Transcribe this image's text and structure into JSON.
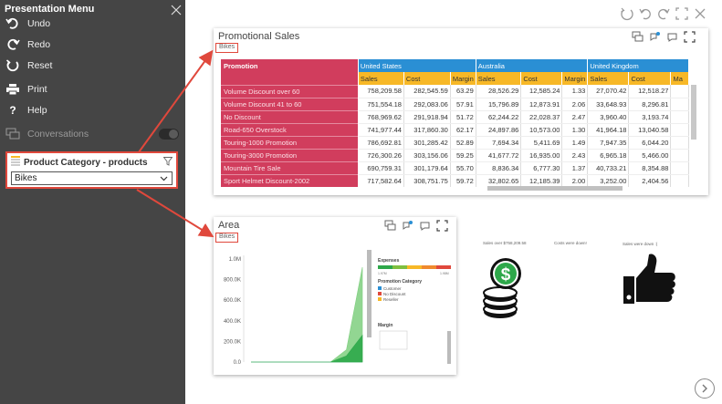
{
  "sidebar": {
    "title": "Presentation Menu",
    "items": [
      {
        "label": "Undo",
        "icon": "undo-icon"
      },
      {
        "label": "Redo",
        "icon": "redo-icon"
      },
      {
        "label": "Reset",
        "icon": "reset-icon"
      },
      {
        "label": "Print",
        "icon": "print-icon"
      },
      {
        "label": "Help",
        "icon": "help-icon"
      },
      {
        "label": "Conversations",
        "icon": "conversations-icon"
      }
    ],
    "filter": {
      "title": "Product Category - products",
      "selected": "Bikes"
    }
  },
  "promo_panel": {
    "title": "Promotional Sales",
    "filter_tag": "Bikes",
    "table": {
      "row_header": "Promotion",
      "countries": [
        "United States",
        "Australia",
        "United Kingdom"
      ],
      "measures": [
        "Sales",
        "Cost",
        "Margin",
        "Sales",
        "Cost",
        "Margin",
        "Sales",
        "Cost",
        "Ma"
      ],
      "rows": [
        {
          "name": "Volume Discount over 60",
          "values": [
            "758,209.58",
            "282,545.59",
            "63.29",
            "28,526.29",
            "12,585.24",
            "1.33",
            "27,070.42",
            "12,518.27"
          ]
        },
        {
          "name": "Volume Discount 41 to 60",
          "values": [
            "751,554.18",
            "292,083.06",
            "57.91",
            "15,796.89",
            "12,873.91",
            "2.06",
            "33,648.93",
            "8,296.81"
          ]
        },
        {
          "name": "No Discount",
          "values": [
            "768,969.62",
            "291,918.94",
            "51.72",
            "62,244.22",
            "22,028.37",
            "2.47",
            "3,960.40",
            "3,193.74"
          ]
        },
        {
          "name": "Road-650 Overstock",
          "values": [
            "741,977.44",
            "317,860.30",
            "62.17",
            "24,897.86",
            "10,573.00",
            "1.30",
            "41,964.18",
            "13,040.58"
          ]
        },
        {
          "name": "Touring-1000 Promotion",
          "values": [
            "786,692.81",
            "301,285.42",
            "52.89",
            "7,694.34",
            "5,411.69",
            "1.49",
            "7,947.35",
            "6,044.20"
          ]
        },
        {
          "name": "Touring-3000 Promotion",
          "values": [
            "726,300.26",
            "303,156.06",
            "59.25",
            "41,677.72",
            "16,935.00",
            "2.43",
            "6,965.18",
            "5,466.00"
          ]
        },
        {
          "name": "Mountain Tire Sale",
          "values": [
            "690,759.31",
            "301,179.64",
            "55.70",
            "8,836.34",
            "6,777.30",
            "1.37",
            "40,733.21",
            "8,354.88"
          ]
        },
        {
          "name": "Sport Helmet Discount-2002",
          "values": [
            "717,582.64",
            "308,751.75",
            "59.72",
            "32,802.65",
            "12,185.39",
            "2.00",
            "3,252.00",
            "2,404.56"
          ]
        }
      ]
    }
  },
  "area_panel": {
    "title": "Area",
    "filter_tag": "Bikes",
    "legend": {
      "expenses_title": "Expenses",
      "expenses_min": "1.97M",
      "expenses_max": "1.98M",
      "category_title": "Promotion Category",
      "categories": [
        "Customer",
        "No Discount",
        "Reseller"
      ],
      "margin_title": "Margin"
    }
  },
  "cards": {
    "sales_label": "Sales over $758,209.58",
    "costs_label": "Costs were down!",
    "sales_down_label": "Sales were down :("
  },
  "chart_data": {
    "type": "area",
    "title": "Area",
    "yticks": [
      "1.0M",
      "800.0K",
      "600.0K",
      "400.0K",
      "200.0K",
      "0.0"
    ],
    "ylim": [
      0,
      1000000
    ],
    "series": [
      {
        "name": "Customer",
        "color": "#2a8fd4",
        "values": [
          0,
          0,
          0,
          0,
          0,
          0,
          0,
          0
        ]
      },
      {
        "name": "No Discount",
        "color": "#7fcf7f",
        "values": [
          0,
          0,
          0,
          0,
          0,
          0,
          120000,
          920000
        ]
      },
      {
        "name": "Reseller",
        "color": "#2ea84a",
        "values": [
          0,
          0,
          0,
          0,
          0,
          0,
          60000,
          260000
        ]
      }
    ]
  },
  "colors": {
    "sidebar_bg": "#454545",
    "highlight_red": "#e0483c",
    "promo_red": "#d13d5d",
    "country_blue": "#2a8fd4",
    "measure_yellow": "#f7b827"
  }
}
